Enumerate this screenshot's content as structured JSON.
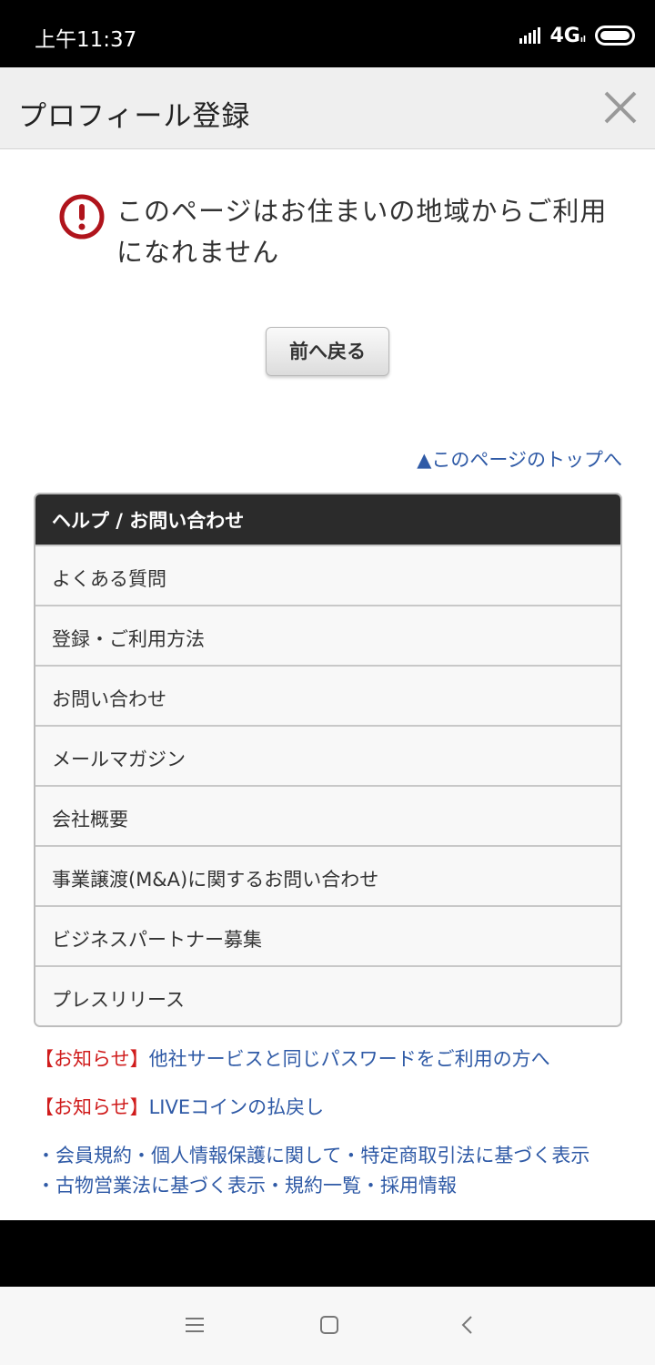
{
  "status_bar": {
    "time": "上午11:37",
    "network": "4G",
    "network_sub": "ıl",
    "icons": [
      "signal-icon",
      "battery-icon"
    ]
  },
  "header": {
    "title": "プロフィール登録",
    "close_icon": "close-icon"
  },
  "error": {
    "icon": "exclamation-circle-icon",
    "message": "このページはお住まいの地域からご利用になれません"
  },
  "back_button": {
    "label": "前へ戻る"
  },
  "to_top": {
    "label": "▲このページのトップへ"
  },
  "help": {
    "heading": "ヘルプ / お問い合わせ",
    "items": [
      "よくある質問",
      "登録・ご利用方法",
      "お問い合わせ",
      "メールマガジン",
      "会社概要",
      "事業譲渡(M&A)に関するお問い合わせ",
      "ビジネスパートナー募集",
      "プレスリリース"
    ]
  },
  "notices": [
    {
      "tag": "【お知らせ】",
      "text": "他社サービスと同じパスワードをご利用の方へ"
    },
    {
      "tag": "【お知らせ】",
      "text": "LIVEコインの払戻し"
    }
  ],
  "footer_links": {
    "line1": "・会員規約・個人情報保護に関して・特定商取引法に基づく表示",
    "line2": "・古物営業法に基づく表示・規約一覧・採用情報"
  },
  "nav_bar": {
    "icons": [
      "menu-icon",
      "home-icon",
      "back-icon"
    ]
  },
  "colors": {
    "link": "#2f5aa6",
    "notice_tag": "#d01c1c",
    "help_header": "#2b2b2b",
    "error_icon": "#b0141c"
  }
}
